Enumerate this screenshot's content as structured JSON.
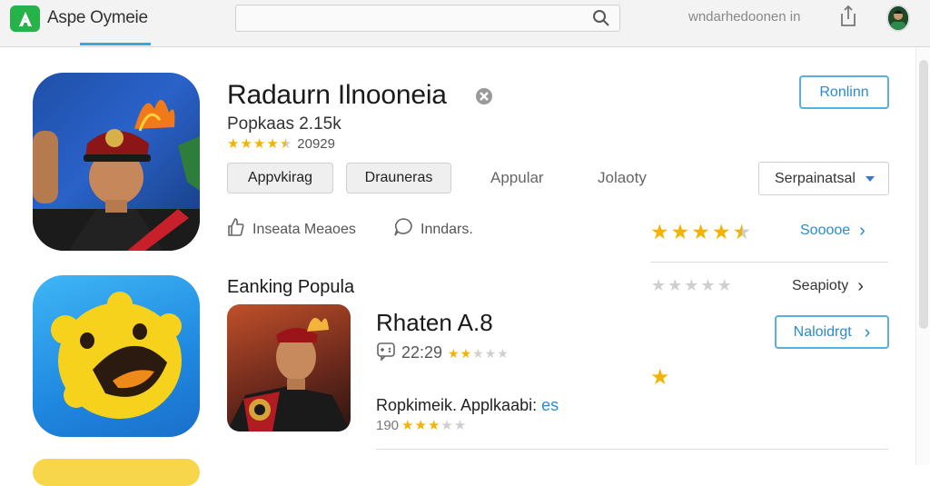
{
  "topbar": {
    "store_name": "Aspe Oymeie",
    "search_placeholder": "",
    "account_name": "wndarhedoonen in"
  },
  "headline_app": {
    "title": "Radaurn Ilnooneia",
    "subtitle": "Popkaas 2.15k",
    "rating": 4.5,
    "rating_count": "20929",
    "primary_button": "Ronlinn",
    "pills": [
      "Appvkirag",
      "Drauneras"
    ],
    "tabs": [
      "Appular",
      "Jolaoty"
    ],
    "sort_select": "Serpainatsal",
    "meta": {
      "like_label": "Inseata Meaoes",
      "comment_label": "Inndars."
    },
    "big_rating": 4.5,
    "see_more_link": "Sooooe"
  },
  "ranking_section": {
    "title": "Eanking Popula",
    "rating": 0,
    "link": "Seapioty"
  },
  "featured_app": {
    "title": "Rhaten A.8",
    "version_text": "22:29",
    "rating": 2,
    "button": "Naloidrgt",
    "lone_star_rating": 1,
    "description": "Ropkimeik. Applkaabi:",
    "description_tag": "es",
    "count": "190",
    "count_rating": 3
  },
  "colors": {
    "accent": "#2a8bd0",
    "star": "#f5b301",
    "brand": "#25b34a"
  }
}
